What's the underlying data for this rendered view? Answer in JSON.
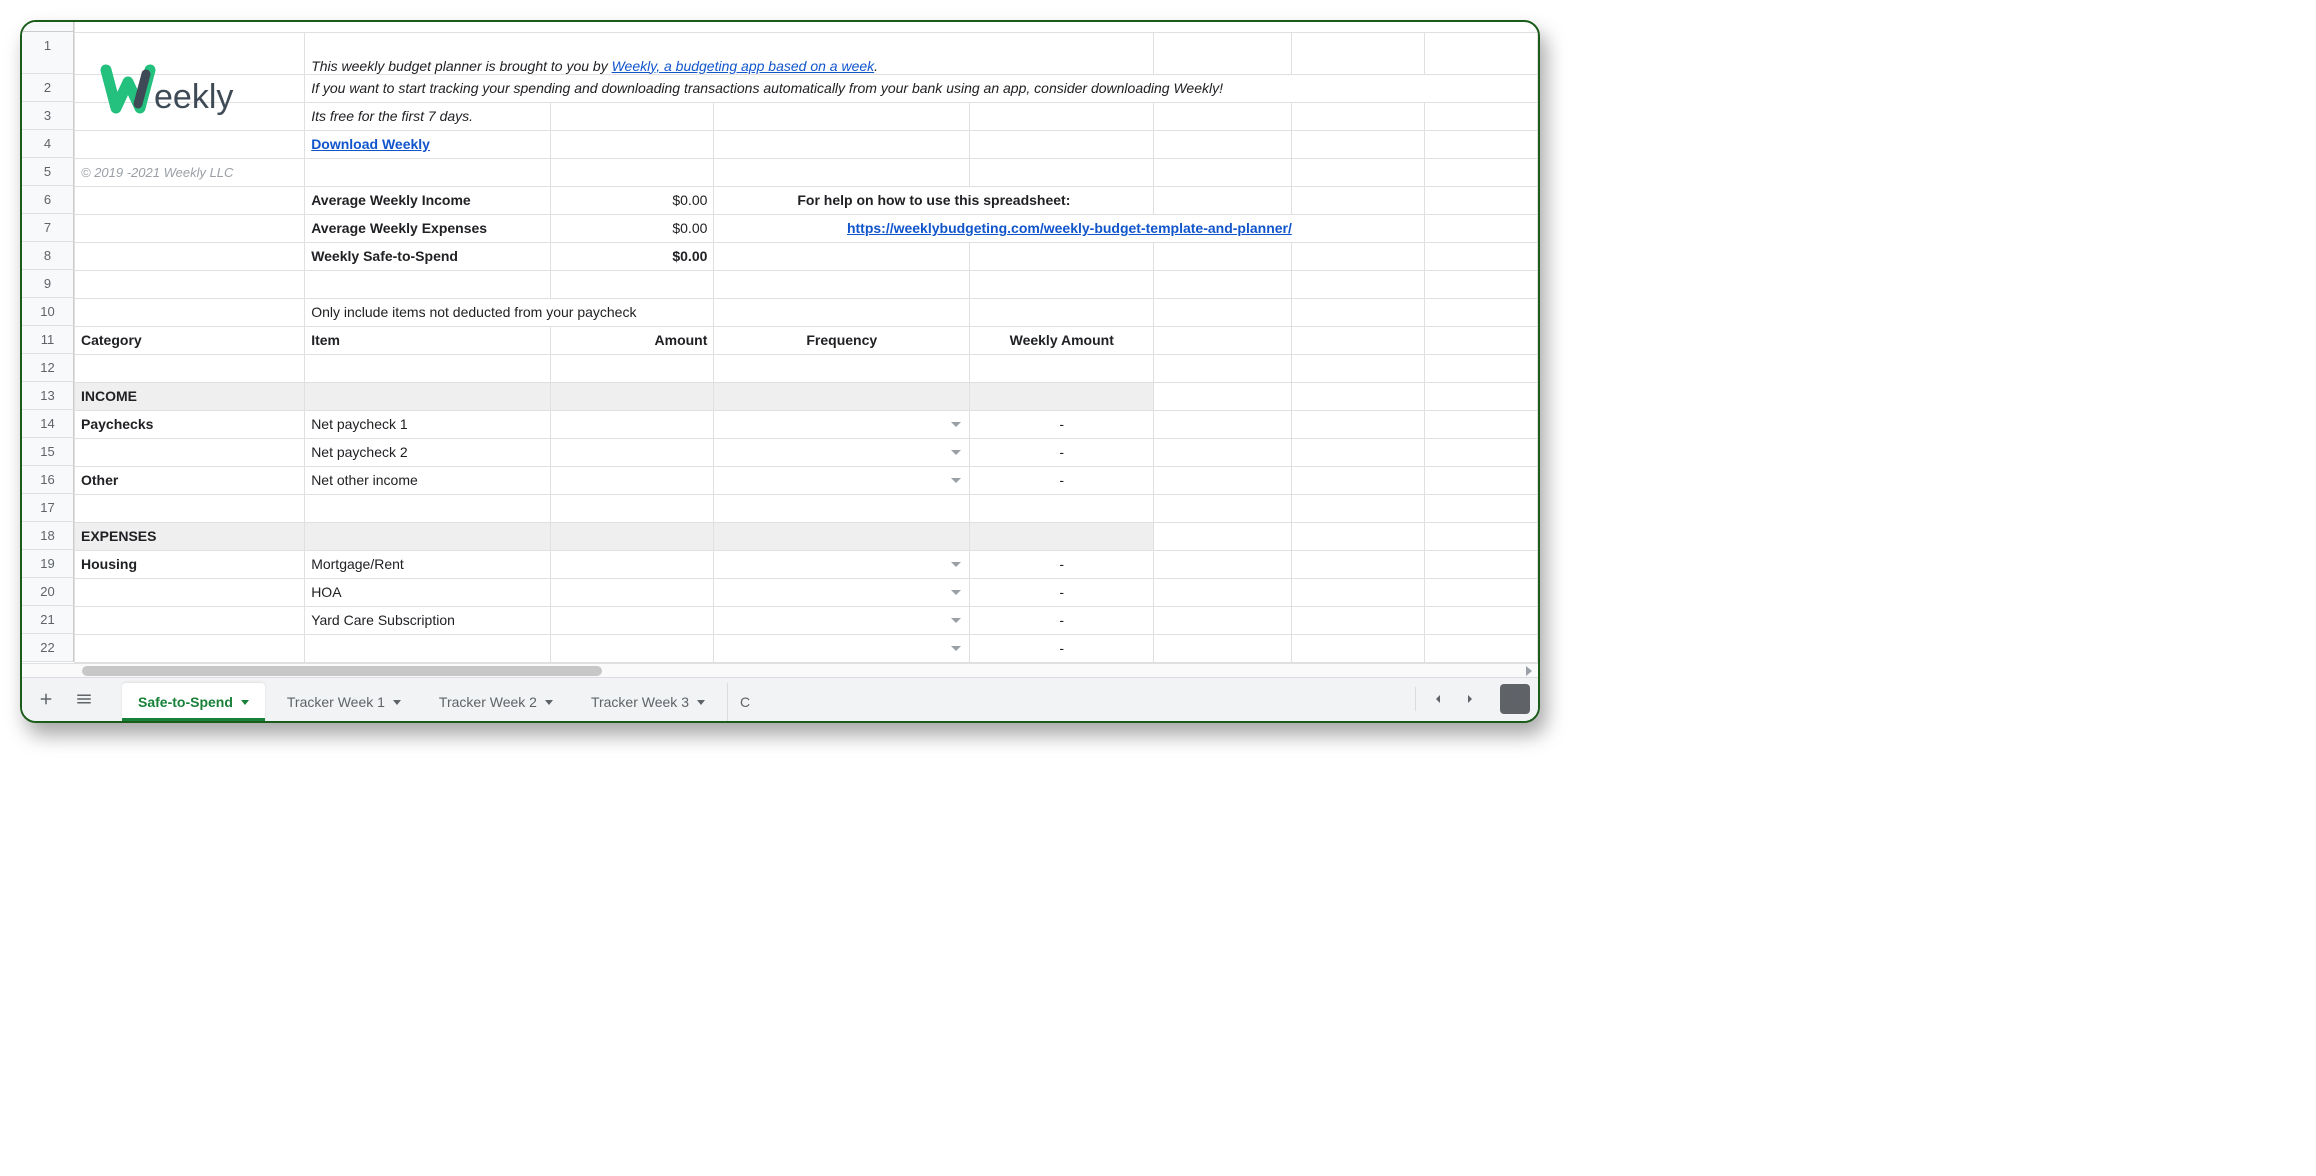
{
  "rows": [
    "1",
    "2",
    "3",
    "4",
    "5",
    "6",
    "7",
    "8",
    "9",
    "10",
    "11",
    "12",
    "13",
    "14",
    "15",
    "16",
    "17",
    "18",
    "19",
    "20",
    "21",
    "22"
  ],
  "copyright": "© 2019 -2021 Weekly LLC",
  "logo_text_eekly": "eekly",
  "intro": {
    "line1_prefix": "This weekly budget planner is brought to you by ",
    "line1_link": "Weekly, a budgeting app based on a week",
    "line1_suffix": ".",
    "line2": "If you want to start tracking your spending and downloading transactions automatically from your bank using an app, consider downloading Weekly!",
    "line3": "Its free for the first 7 days.",
    "download_link": "Download Weekly"
  },
  "summary": {
    "avg_income_label": "Average Weekly Income",
    "avg_income_value": "$0.00",
    "avg_exp_label": "Average Weekly Expenses",
    "avg_exp_value": "$0.00",
    "safe_label": "Weekly Safe-to-Spend",
    "safe_value": "$0.00",
    "help_label": "For help on how to use this spreadsheet:",
    "help_link": "https://weeklybudgeting.com/weekly-budget-template-and-planner/"
  },
  "note": "Only include items not deducted from your paycheck",
  "headers": {
    "category": "Category",
    "item": "Item",
    "amount": "Amount",
    "frequency": "Frequency",
    "weekly_amount": "Weekly Amount"
  },
  "sections": {
    "income": "INCOME",
    "paychecks": "Paychecks",
    "other": "Other",
    "expenses": "EXPENSES",
    "housing": "Housing"
  },
  "items": {
    "net_paycheck_1": "Net paycheck 1",
    "net_paycheck_2": "Net paycheck 2",
    "net_other": "Net other income",
    "mortgage": "Mortgage/Rent",
    "hoa": "HOA",
    "yard": "Yard Care Subscription"
  },
  "dash": "-",
  "tabs": {
    "active": "Safe-to-Spend",
    "t1": "Tracker Week 1",
    "t2": "Tracker Week 2",
    "t3": "Tracker Week 3",
    "partial": "C"
  }
}
